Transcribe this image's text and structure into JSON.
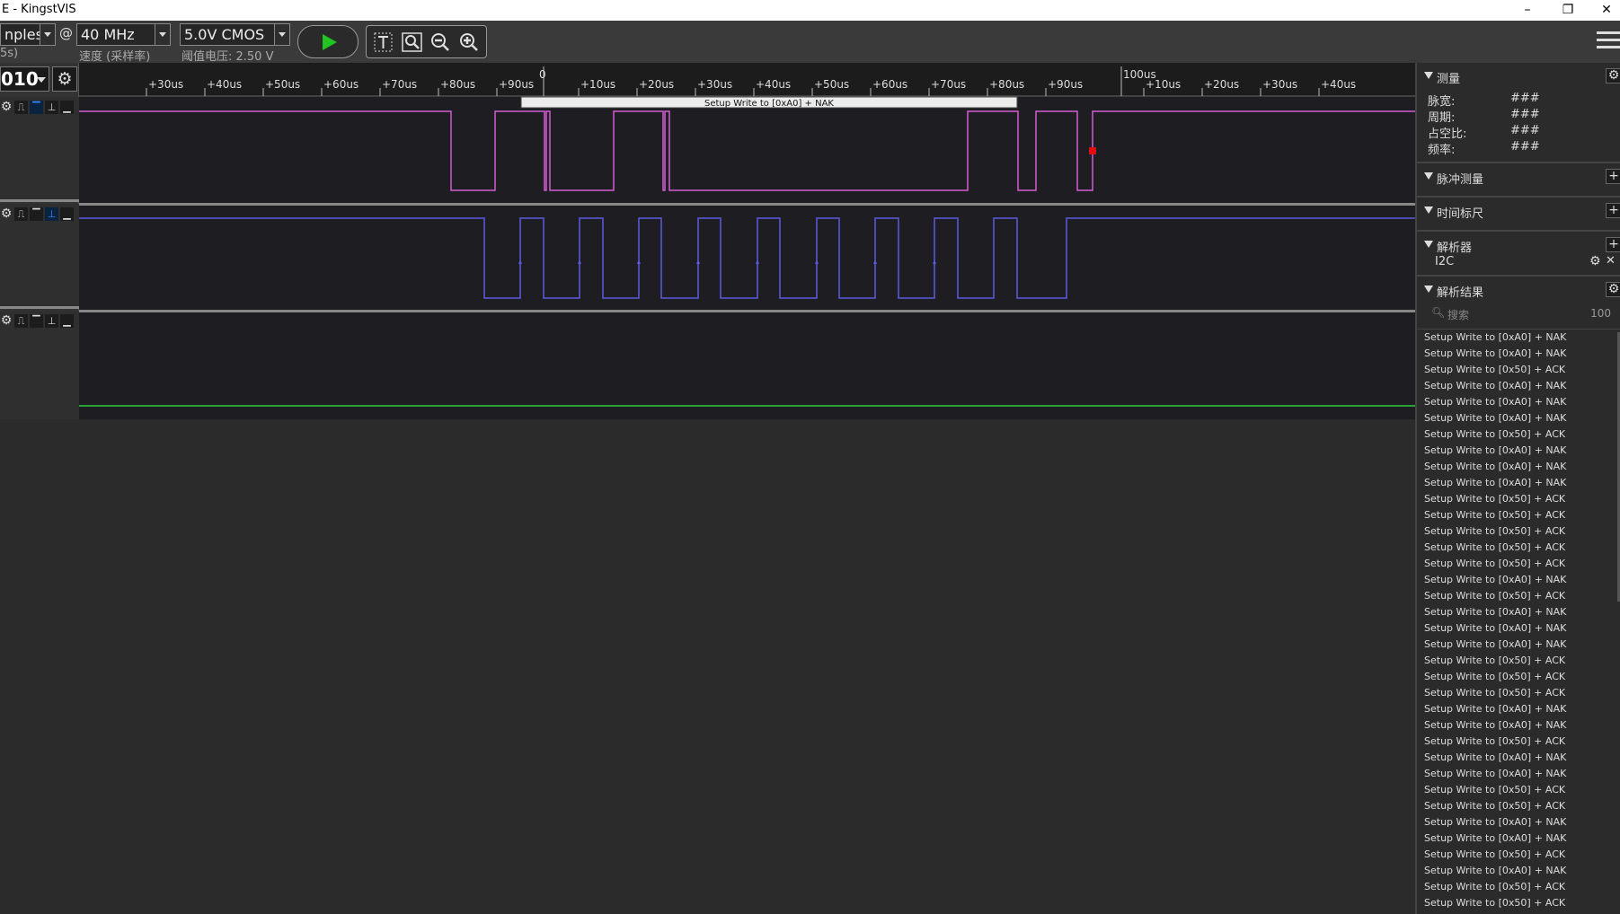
{
  "window": {
    "title": "E - KingstVIS",
    "minimize_glyph": "–",
    "restore_glyph": "❐",
    "close_glyph": "✕"
  },
  "toolbar": {
    "samples_value": "nples",
    "samples_sub": "5s)",
    "at_sign": "@",
    "rate_value": "40 MHz",
    "rate_sub": "速度 (采样率)",
    "voltage_value": "5.0V CMOS",
    "voltage_sub": "阈值电压: 2.50 V",
    "run_icon": "play-icon",
    "tools": [
      "text-cursor-icon",
      "zoom-fit-icon",
      "zoom-out-icon",
      "zoom-in-icon"
    ],
    "menu_icon": "hamburger-icon"
  },
  "ruler": {
    "number_value": "010",
    "labels_first": [
      "+30us",
      "+40us",
      "+50us",
      "+60us",
      "+70us",
      "+80us",
      "+90us"
    ],
    "zero_label": "0",
    "labels_second": [
      "+10us",
      "+20us",
      "+30us",
      "+40us",
      "+50us",
      "+60us",
      "+70us",
      "+80us",
      "+90us"
    ],
    "hundred_label": "100us",
    "labels_third": [
      "+10us",
      "+20us",
      "+30us",
      "+40us"
    ]
  },
  "channels": [
    {
      "id": "ch0",
      "color": "#d35ed3",
      "icons": [
        "gear-icon",
        "rising-edge-icon",
        "high-level-icon",
        "falling-edge-icon",
        "low-level-icon"
      ],
      "selected_icon": 2
    },
    {
      "id": "ch1",
      "color": "#5a5ae0",
      "icons": [
        "gear-icon",
        "rising-edge-icon",
        "high-level-icon",
        "falling-edge-icon",
        "low-level-icon"
      ],
      "selected_icon": 3
    },
    {
      "id": "ch2",
      "color": "#2ecc40",
      "icons": [
        "gear-icon",
        "rising-edge-icon",
        "high-level-icon",
        "falling-edge-icon",
        "low-level-icon"
      ],
      "selected_icon": -1
    }
  ],
  "decode_label": "Setup Write to [0xA0] + NAK",
  "marker_color": "#e01010",
  "panel": {
    "measure": {
      "title": "测量",
      "rows": [
        {
          "label": "脉宽:",
          "value": "###"
        },
        {
          "label": "周期:",
          "value": "###"
        },
        {
          "label": "占空比:",
          "value": "###"
        },
        {
          "label": "频率:",
          "value": "###"
        }
      ]
    },
    "pulse_title": "脉冲测量",
    "timestamp_title": "时间标尺",
    "analyzer": {
      "title": "解析器",
      "item": "I2C"
    },
    "results": {
      "title": "解析结果",
      "search_placeholder": "搜索",
      "count": "100",
      "rows": [
        "Setup Write to [0xA0] + NAK",
        "Setup Write to [0xA0] + NAK",
        "Setup Write to [0x50] + ACK",
        "Setup Write to [0xA0] + NAK",
        "Setup Write to [0xA0] + NAK",
        "Setup Write to [0xA0] + NAK",
        "Setup Write to [0x50] + ACK",
        "Setup Write to [0xA0] + NAK",
        "Setup Write to [0xA0] + NAK",
        "Setup Write to [0xA0] + NAK",
        "Setup Write to [0x50] + ACK",
        "Setup Write to [0x50] + ACK",
        "Setup Write to [0x50] + ACK",
        "Setup Write to [0x50] + ACK",
        "Setup Write to [0x50] + ACK",
        "Setup Write to [0xA0] + NAK",
        "Setup Write to [0x50] + ACK",
        "Setup Write to [0xA0] + NAK",
        "Setup Write to [0xA0] + NAK",
        "Setup Write to [0xA0] + NAK",
        "Setup Write to [0x50] + ACK",
        "Setup Write to [0x50] + ACK",
        "Setup Write to [0x50] + ACK",
        "Setup Write to [0xA0] + NAK",
        "Setup Write to [0xA0] + NAK",
        "Setup Write to [0x50] + ACK",
        "Setup Write to [0xA0] + NAK",
        "Setup Write to [0xA0] + NAK",
        "Setup Write to [0x50] + ACK",
        "Setup Write to [0x50] + ACK",
        "Setup Write to [0xA0] + NAK",
        "Setup Write to [0xA0] + NAK",
        "Setup Write to [0x50] + ACK",
        "Setup Write to [0xA0] + NAK",
        "Setup Write to [0x50] + ACK",
        "Setup Write to [0x50] + ACK"
      ]
    }
  }
}
